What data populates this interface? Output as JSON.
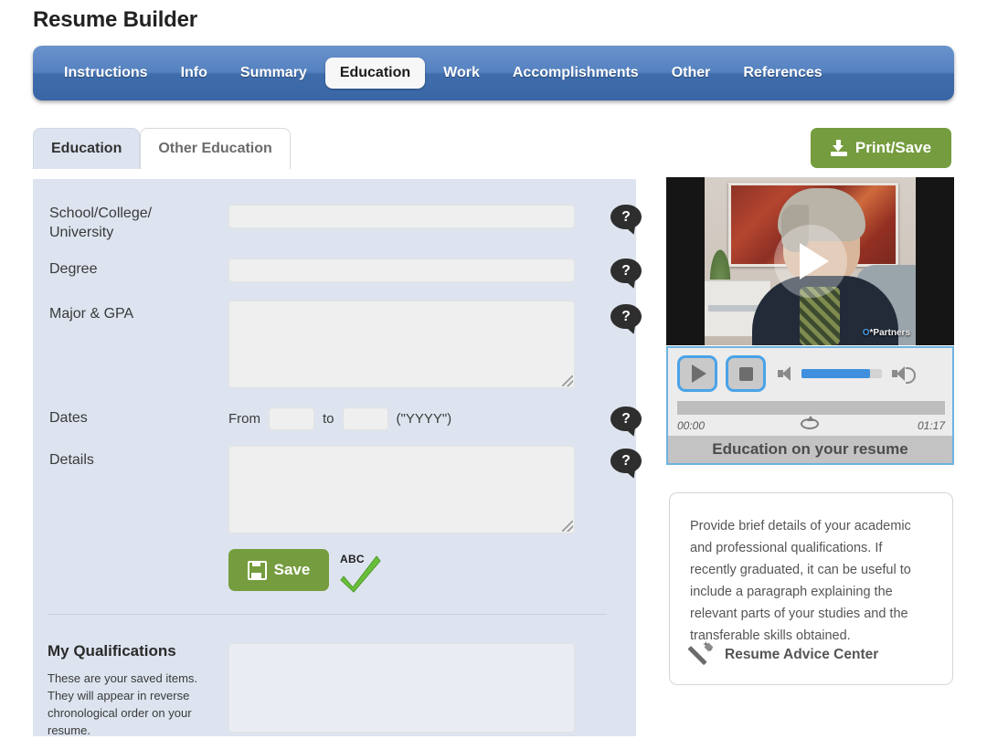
{
  "app": {
    "title": "Resume Builder"
  },
  "nav": {
    "items": [
      {
        "label": "Instructions",
        "active": false
      },
      {
        "label": "Info",
        "active": false
      },
      {
        "label": "Summary",
        "active": false
      },
      {
        "label": "Education",
        "active": true
      },
      {
        "label": "Work",
        "active": false
      },
      {
        "label": "Accomplishments",
        "active": false
      },
      {
        "label": "Other",
        "active": false
      },
      {
        "label": "References",
        "active": false
      }
    ]
  },
  "subtabs": {
    "items": [
      {
        "label": "Education",
        "active": true
      },
      {
        "label": "Other Education",
        "active": false
      }
    ]
  },
  "toolbar": {
    "print_save_label": "Print/Save",
    "print_save_icon": "download-icon",
    "accent_green": "#759c3e"
  },
  "form": {
    "fields": [
      {
        "label": "School/College/\nUniversity",
        "value": "",
        "type": "text",
        "help_icon": "help-bubble-icon"
      },
      {
        "label": "Degree",
        "value": "",
        "type": "text",
        "help_icon": "help-bubble-icon"
      },
      {
        "label": "Major & GPA",
        "value": "",
        "type": "textarea",
        "help_icon": "help-bubble-icon"
      },
      {
        "label": "Details",
        "value": "",
        "type": "textarea",
        "help_icon": "help-bubble-icon"
      }
    ],
    "dates": {
      "label": "Dates",
      "from_label": "From",
      "from_value": "",
      "to_label": "to",
      "to_value": "",
      "format_hint": "(\"YYYY\")",
      "help_icon": "help-bubble-icon"
    },
    "save_label": "Save",
    "save_icon": "floppy-disk-icon",
    "spellcheck_label": "ABC",
    "spellcheck_icon": "spellcheck-icon"
  },
  "qualifications": {
    "heading": "My Qualifications",
    "description": "These are your saved items. They will appear in reverse chronological order on your resume.",
    "list_value": ""
  },
  "video": {
    "title": "Education on your resume",
    "play_icon": "play-icon",
    "watermark": "O*Partners",
    "player": {
      "play_icon": "play-icon",
      "stop_icon": "stop-icon",
      "mute_icon": "speaker-mute-icon",
      "volume_icon": "speaker-volume-icon",
      "volume_percent": 85,
      "progress_percent": 0,
      "time_current": "00:00",
      "time_total": "01:17",
      "loop_icon": "loop-icon",
      "focus_color": "#4aa3e8"
    }
  },
  "advice": {
    "text": "Provide brief details of your academic and professional qualifications. If recently graduated, it can be useful to include a paragraph explaining the relevant parts of your studies and the transferable skills obtained.",
    "link_label": "Resume Advice Center",
    "link_icon": "magic-wand-icon"
  }
}
